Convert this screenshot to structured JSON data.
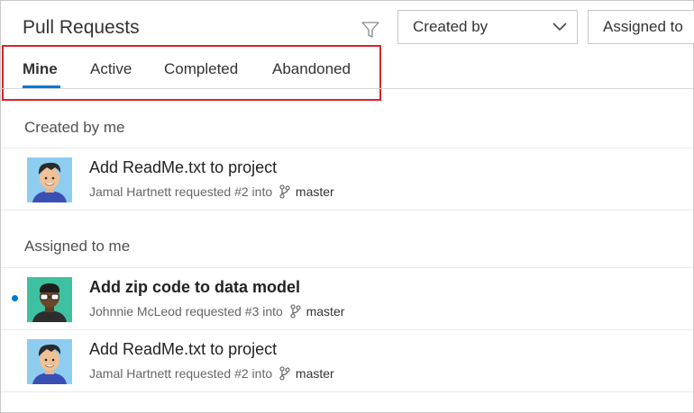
{
  "header": {
    "title": "Pull Requests",
    "filter_icon": "filter-icon",
    "created_by_dropdown": {
      "label": "Created by",
      "icon": "chevron-down-icon"
    },
    "assigned_to_dropdown": {
      "label": "Assigned to"
    }
  },
  "tabs": [
    {
      "label": "Mine",
      "active": true
    },
    {
      "label": "Active",
      "active": false
    },
    {
      "label": "Completed",
      "active": false
    },
    {
      "label": "Abandoned",
      "active": false
    }
  ],
  "colors": {
    "accent": "#0078d4",
    "highlight": "#d9232a"
  },
  "sections": [
    {
      "header": "Created by me",
      "items": [
        {
          "title": "Add ReadMe.txt to project",
          "meta": "Jamal Hartnett requested #2 into",
          "branch": "master",
          "unread": false,
          "avatar_icon": "avatar-jamal"
        }
      ]
    },
    {
      "header": "Assigned to me",
      "items": [
        {
          "title": "Add zip code to data model",
          "meta": "Johnnie McLeod requested #3 into",
          "branch": "master",
          "unread": true,
          "avatar_icon": "avatar-johnnie"
        },
        {
          "title": "Add ReadMe.txt to project",
          "meta": "Jamal Hartnett requested #2 into",
          "branch": "master",
          "unread": false,
          "avatar_icon": "avatar-jamal"
        }
      ]
    }
  ]
}
